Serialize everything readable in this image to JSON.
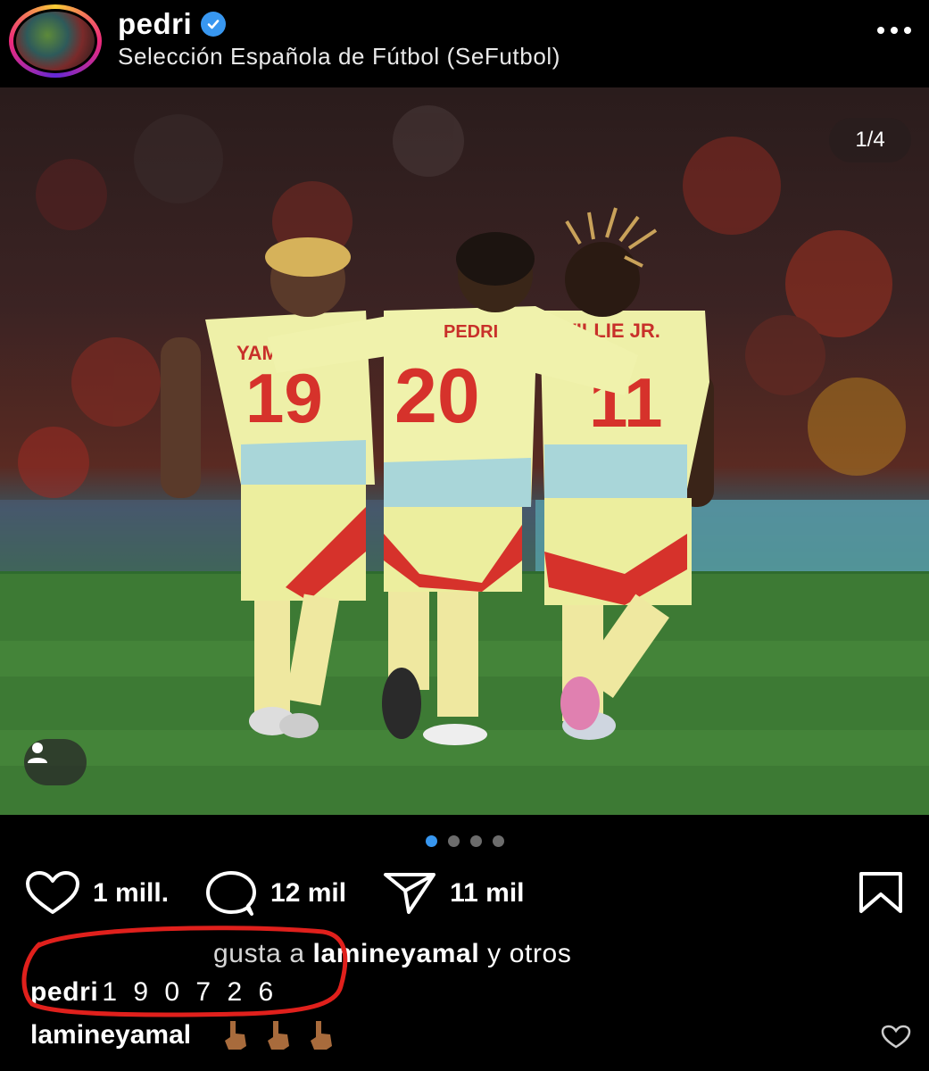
{
  "header": {
    "username": "pedri",
    "subtitle": "Selección Española de Fútbol (SeFutbol)",
    "verified_color": "#3897f0"
  },
  "photo": {
    "counter": "1/4",
    "jersey_names": [
      "YAMAL",
      "PEDRI",
      "WILLIE  JR."
    ],
    "jersey_numbers": [
      "19",
      "20",
      "11"
    ]
  },
  "carousel": {
    "total": 4,
    "active": 1,
    "active_color": "#3897f0"
  },
  "actions": {
    "likes": "1 mill.",
    "comments": "12 mil",
    "shares": "11 mil"
  },
  "likes_line": {
    "partial": "gusta a ",
    "user": "lamineyamal",
    "suffix": " y otros"
  },
  "caption": {
    "user": "pedri",
    "text": "1 9 0 7 2 6"
  },
  "comment": {
    "user": "lamineyamal",
    "emoji": [
      "pointing-up-hand",
      "pointing-up-hand",
      "pointing-up-hand"
    ]
  },
  "annotation_color": "#e0201c"
}
